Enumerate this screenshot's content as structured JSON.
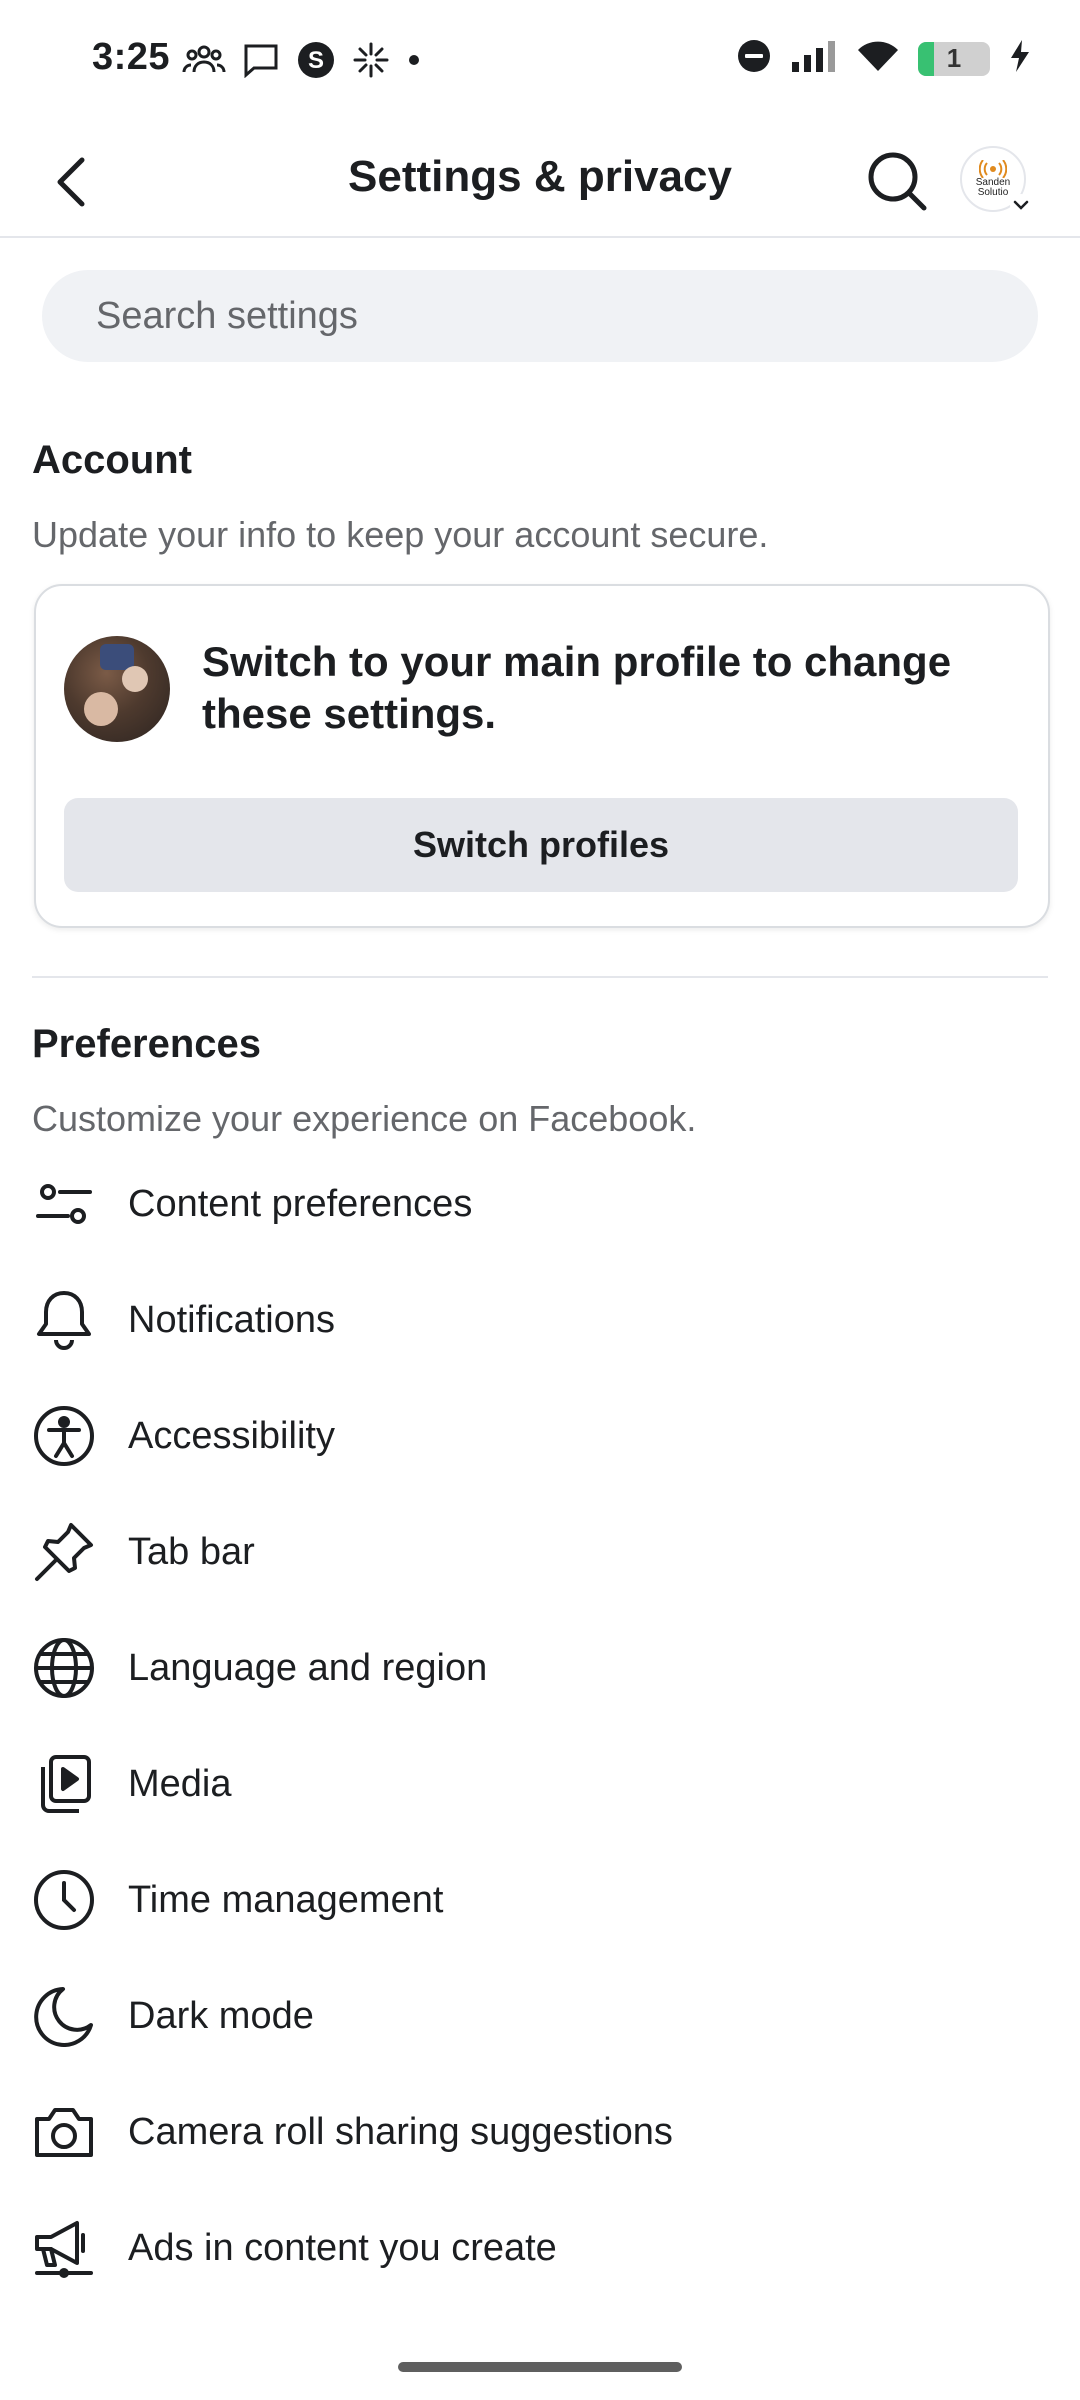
{
  "status_bar": {
    "time": "3:25",
    "left_icons": [
      "groups-icon",
      "chat-icon",
      "skype-icon",
      "asterisk-icon",
      "dot-icon"
    ],
    "right_icons": [
      "do-not-disturb-icon",
      "signal-icon",
      "wifi-icon",
      "battery-icon",
      "charging-icon"
    ],
    "battery_level": "1"
  },
  "header": {
    "title": "Settings & privacy",
    "avatar_text": "Sanden Solutio"
  },
  "search": {
    "placeholder": "Search settings"
  },
  "account": {
    "title": "Account",
    "subtitle": "Update your info to keep your account secure.",
    "card_text": "Switch to your main profile to change these settings.",
    "switch_button": "Switch profiles"
  },
  "preferences": {
    "title": "Preferences",
    "subtitle": "Customize your experience on Facebook.",
    "items": [
      {
        "label": "Content preferences",
        "icon": "sliders-icon"
      },
      {
        "label": "Notifications",
        "icon": "bell-icon"
      },
      {
        "label": "Accessibility",
        "icon": "accessibility-icon"
      },
      {
        "label": "Tab bar",
        "icon": "pin-icon"
      },
      {
        "label": "Language and region",
        "icon": "globe-icon"
      },
      {
        "label": "Media",
        "icon": "media-icon"
      },
      {
        "label": "Time management",
        "icon": "clock-icon"
      },
      {
        "label": "Dark mode",
        "icon": "moon-icon"
      },
      {
        "label": "Camera roll sharing suggestions",
        "icon": "camera-icon"
      },
      {
        "label": "Ads in content you create",
        "icon": "megaphone-icon"
      }
    ]
  },
  "colors": {
    "text": "#1c1e21",
    "secondary_text": "#65676b",
    "search_bg": "#f0f2f5",
    "button_bg": "#e4e6eb",
    "divider": "#e4e6eb"
  }
}
